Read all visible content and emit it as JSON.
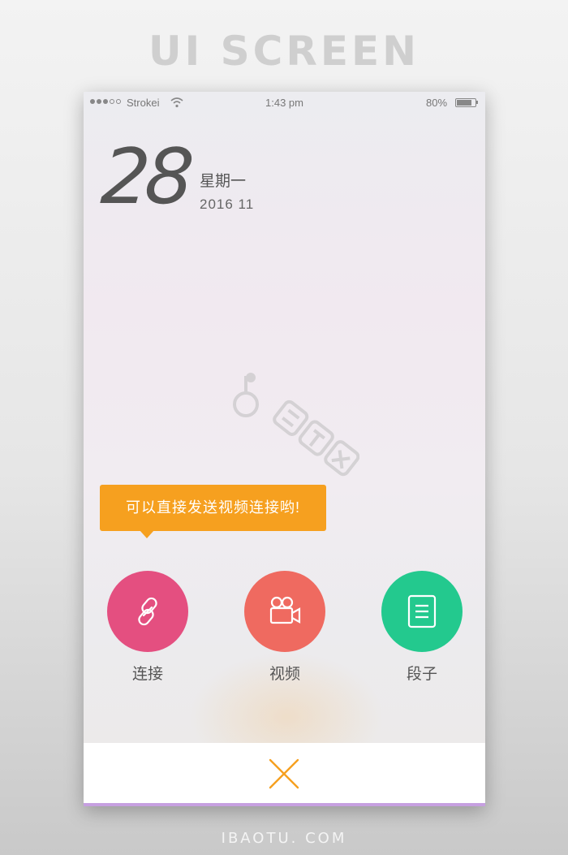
{
  "header": {
    "title": "UI SCREEN"
  },
  "footer": {
    "brand": "IBAOTU. COM"
  },
  "status_bar": {
    "carrier": "Strokei",
    "time": "1:43 pm",
    "battery_percent": "80%",
    "battery_level": 0.8
  },
  "date_widget": {
    "day": "28",
    "weekday": "星期一",
    "year_month": "2016 11"
  },
  "watermark": {
    "text": "包图网"
  },
  "tooltip": {
    "text": "可以直接发送视频连接哟!"
  },
  "actions": [
    {
      "label": "连接",
      "icon": "link-icon",
      "color": "#e44f80"
    },
    {
      "label": "视频",
      "icon": "video-camera-icon",
      "color": "#ef6a60"
    },
    {
      "label": "段子",
      "icon": "document-icon",
      "color": "#23c98e"
    }
  ],
  "close": {
    "icon": "close-icon",
    "color": "#f6a01f"
  },
  "colors": {
    "accent": "#f6a01f",
    "bottom_line": "#c6a0e0"
  }
}
